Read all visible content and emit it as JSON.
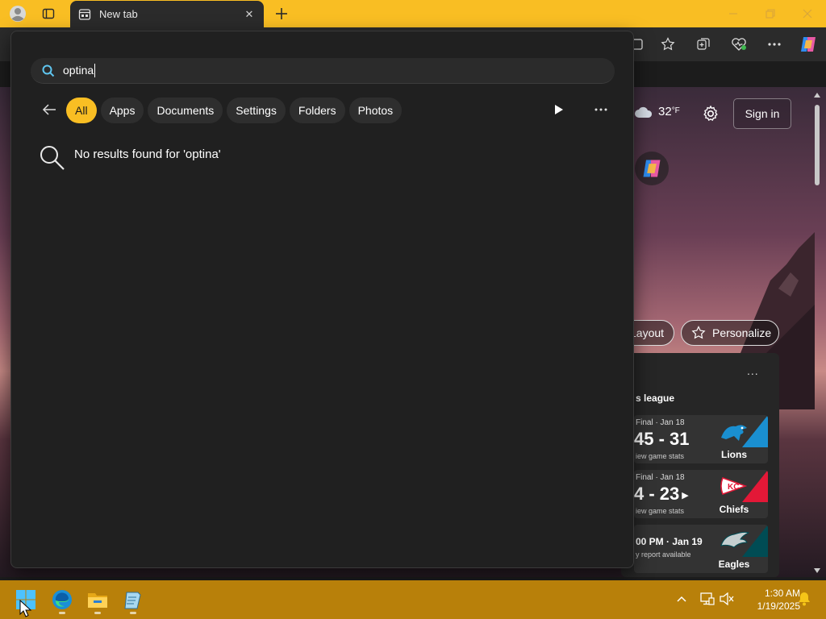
{
  "browser": {
    "tab_title": "New tab",
    "tab_close_glyph": "✕",
    "window_controls": [
      "minimize-icon",
      "restore-icon",
      "close-icon"
    ],
    "toolbar_icons": [
      "favorites-icon",
      "collections-icon",
      "browser-essentials-icon",
      "more-icon",
      "copilot-icon"
    ]
  },
  "newtab_page": {
    "weather_temp": "32",
    "weather_unit": "°F",
    "sign_in_label": "Sign in",
    "layout_label": "Layout",
    "personalize_label": "Personalize",
    "sports": {
      "more_glyph": "...",
      "league": "s league",
      "games": [
        {
          "status": "Final · Jan 18",
          "score": "45 - 31",
          "link": "iew game stats",
          "team": "Lions"
        },
        {
          "status": "Final · Jan 18",
          "score": "4 - 23",
          "link": "iew game stats",
          "team": "Chiefs"
        },
        {
          "status": "00 PM · Jan 19",
          "score": "",
          "link": "y report available",
          "team": "Eagles"
        }
      ]
    }
  },
  "search": {
    "query": "optina",
    "filters": [
      "All",
      "Apps",
      "Documents",
      "Settings",
      "Folders",
      "Photos"
    ],
    "active_filter": "All",
    "more_glyph": "···",
    "no_results": "No results found for 'optina'"
  },
  "taskbar": {
    "apps": [
      "start-icon",
      "edge-icon",
      "file-explorer-icon",
      "notepad-icon"
    ],
    "time": "1:30 AM",
    "date": "1/19/2025"
  },
  "colors": {
    "accent": "#f9be23",
    "taskbar": "#b8800a",
    "flyout_bg": "#202020"
  }
}
